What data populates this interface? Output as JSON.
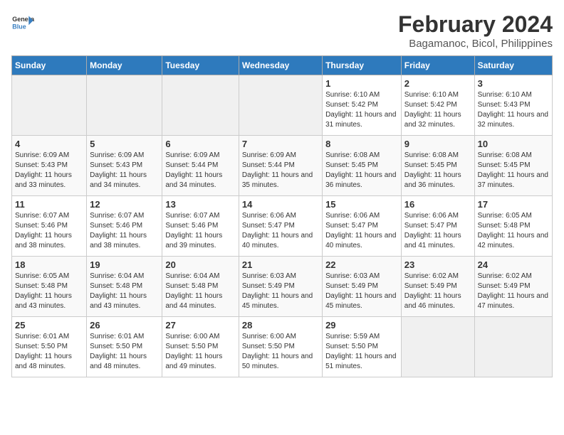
{
  "logo": {
    "line1": "General",
    "line2": "Blue"
  },
  "title": "February 2024",
  "subtitle": "Bagamanoc, Bicol, Philippines",
  "headers": [
    "Sunday",
    "Monday",
    "Tuesday",
    "Wednesday",
    "Thursday",
    "Friday",
    "Saturday"
  ],
  "weeks": [
    [
      {
        "day": "",
        "info": ""
      },
      {
        "day": "",
        "info": ""
      },
      {
        "day": "",
        "info": ""
      },
      {
        "day": "",
        "info": ""
      },
      {
        "day": "1",
        "info": "Sunrise: 6:10 AM\nSunset: 5:42 PM\nDaylight: 11 hours and 31 minutes."
      },
      {
        "day": "2",
        "info": "Sunrise: 6:10 AM\nSunset: 5:42 PM\nDaylight: 11 hours and 32 minutes."
      },
      {
        "day": "3",
        "info": "Sunrise: 6:10 AM\nSunset: 5:43 PM\nDaylight: 11 hours and 32 minutes."
      }
    ],
    [
      {
        "day": "4",
        "info": "Sunrise: 6:09 AM\nSunset: 5:43 PM\nDaylight: 11 hours and 33 minutes."
      },
      {
        "day": "5",
        "info": "Sunrise: 6:09 AM\nSunset: 5:43 PM\nDaylight: 11 hours and 34 minutes."
      },
      {
        "day": "6",
        "info": "Sunrise: 6:09 AM\nSunset: 5:44 PM\nDaylight: 11 hours and 34 minutes."
      },
      {
        "day": "7",
        "info": "Sunrise: 6:09 AM\nSunset: 5:44 PM\nDaylight: 11 hours and 35 minutes."
      },
      {
        "day": "8",
        "info": "Sunrise: 6:08 AM\nSunset: 5:45 PM\nDaylight: 11 hours and 36 minutes."
      },
      {
        "day": "9",
        "info": "Sunrise: 6:08 AM\nSunset: 5:45 PM\nDaylight: 11 hours and 36 minutes."
      },
      {
        "day": "10",
        "info": "Sunrise: 6:08 AM\nSunset: 5:45 PM\nDaylight: 11 hours and 37 minutes."
      }
    ],
    [
      {
        "day": "11",
        "info": "Sunrise: 6:07 AM\nSunset: 5:46 PM\nDaylight: 11 hours and 38 minutes."
      },
      {
        "day": "12",
        "info": "Sunrise: 6:07 AM\nSunset: 5:46 PM\nDaylight: 11 hours and 38 minutes."
      },
      {
        "day": "13",
        "info": "Sunrise: 6:07 AM\nSunset: 5:46 PM\nDaylight: 11 hours and 39 minutes."
      },
      {
        "day": "14",
        "info": "Sunrise: 6:06 AM\nSunset: 5:47 PM\nDaylight: 11 hours and 40 minutes."
      },
      {
        "day": "15",
        "info": "Sunrise: 6:06 AM\nSunset: 5:47 PM\nDaylight: 11 hours and 40 minutes."
      },
      {
        "day": "16",
        "info": "Sunrise: 6:06 AM\nSunset: 5:47 PM\nDaylight: 11 hours and 41 minutes."
      },
      {
        "day": "17",
        "info": "Sunrise: 6:05 AM\nSunset: 5:48 PM\nDaylight: 11 hours and 42 minutes."
      }
    ],
    [
      {
        "day": "18",
        "info": "Sunrise: 6:05 AM\nSunset: 5:48 PM\nDaylight: 11 hours and 43 minutes."
      },
      {
        "day": "19",
        "info": "Sunrise: 6:04 AM\nSunset: 5:48 PM\nDaylight: 11 hours and 43 minutes."
      },
      {
        "day": "20",
        "info": "Sunrise: 6:04 AM\nSunset: 5:48 PM\nDaylight: 11 hours and 44 minutes."
      },
      {
        "day": "21",
        "info": "Sunrise: 6:03 AM\nSunset: 5:49 PM\nDaylight: 11 hours and 45 minutes."
      },
      {
        "day": "22",
        "info": "Sunrise: 6:03 AM\nSunset: 5:49 PM\nDaylight: 11 hours and 45 minutes."
      },
      {
        "day": "23",
        "info": "Sunrise: 6:02 AM\nSunset: 5:49 PM\nDaylight: 11 hours and 46 minutes."
      },
      {
        "day": "24",
        "info": "Sunrise: 6:02 AM\nSunset: 5:49 PM\nDaylight: 11 hours and 47 minutes."
      }
    ],
    [
      {
        "day": "25",
        "info": "Sunrise: 6:01 AM\nSunset: 5:50 PM\nDaylight: 11 hours and 48 minutes."
      },
      {
        "day": "26",
        "info": "Sunrise: 6:01 AM\nSunset: 5:50 PM\nDaylight: 11 hours and 48 minutes."
      },
      {
        "day": "27",
        "info": "Sunrise: 6:00 AM\nSunset: 5:50 PM\nDaylight: 11 hours and 49 minutes."
      },
      {
        "day": "28",
        "info": "Sunrise: 6:00 AM\nSunset: 5:50 PM\nDaylight: 11 hours and 50 minutes."
      },
      {
        "day": "29",
        "info": "Sunrise: 5:59 AM\nSunset: 5:50 PM\nDaylight: 11 hours and 51 minutes."
      },
      {
        "day": "",
        "info": ""
      },
      {
        "day": "",
        "info": ""
      }
    ]
  ]
}
